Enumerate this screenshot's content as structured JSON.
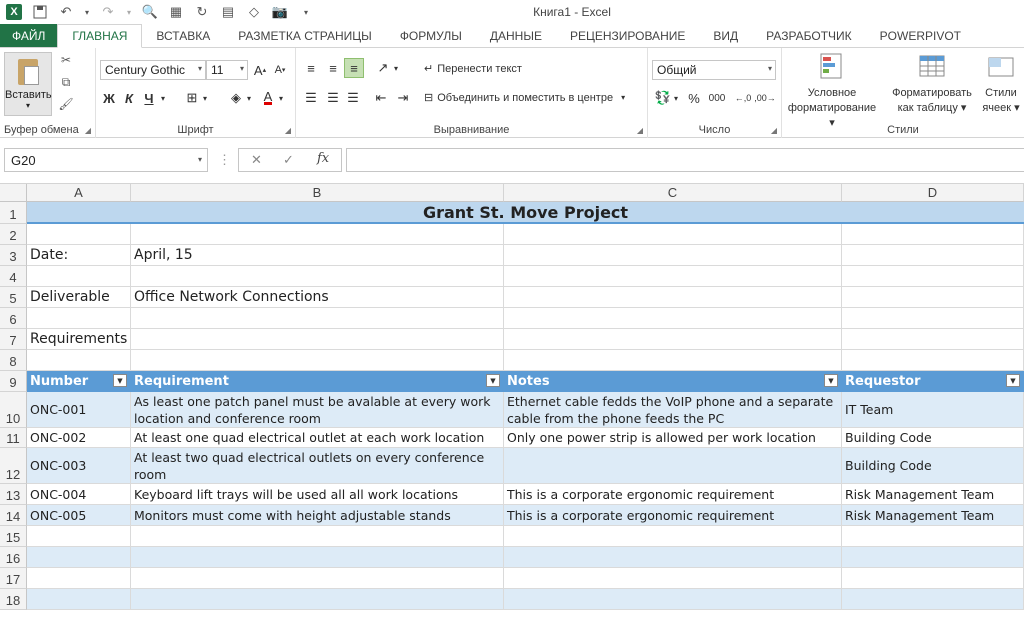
{
  "window": {
    "title": "Книга1 - Excel"
  },
  "ribbon_tabs": [
    "ФАЙЛ",
    "ГЛАВНАЯ",
    "ВСТАВКА",
    "РАЗМЕТКА СТРАНИЦЫ",
    "ФОРМУЛЫ",
    "ДАННЫЕ",
    "РЕЦЕНЗИРОВАНИЕ",
    "ВИД",
    "РАЗРАБОТЧИК",
    "POWERPIVOT"
  ],
  "active_tab": "ГЛАВНАЯ",
  "clipboard": {
    "paste_label": "Вставить",
    "group_label": "Буфер обмена"
  },
  "font": {
    "name": "Century Gothic",
    "size": "11",
    "bold": "Ж",
    "italic": "К",
    "underline": "Ч",
    "group_label": "Шрифт"
  },
  "alignment": {
    "wrap_text": "Перенести текст",
    "merge_center": "Объединить и поместить в центре",
    "group_label": "Выравнивание"
  },
  "number": {
    "format": "Общий",
    "group_label": "Число"
  },
  "styles": {
    "conditional": [
      "Условное",
      "форматирование"
    ],
    "as_table": [
      "Форматировать",
      "как таблицу"
    ],
    "cell_styles": [
      "Стили",
      "ячеек"
    ],
    "group_label": "Стили"
  },
  "formula_bar": {
    "name_box": "G20",
    "fx": "fx",
    "value": ""
  },
  "columns": [
    "A",
    "B",
    "C",
    "D"
  ],
  "rows": [
    "1",
    "2",
    "3",
    "4",
    "5",
    "6",
    "7",
    "8",
    "9",
    "10",
    "11",
    "12",
    "13",
    "14",
    "15",
    "16",
    "17",
    "18"
  ],
  "sheet": {
    "title": "Grant St. Move Project",
    "date_label": "Date:",
    "date_value": "April, 15",
    "deliverable_label": "Deliverable",
    "deliverable_value": "Office Network Connections",
    "requirements_label": "Requirements",
    "table_headers": [
      "Number",
      "Requirement",
      "Notes",
      "Requestor"
    ],
    "table_rows": [
      {
        "number": "ONC-001",
        "requirement": "As least one patch panel must be avalable at every work location and conference room",
        "notes": "Ethernet cable fedds the VoIP phone and a separate cable from the phone feeds the PC",
        "requestor": "IT Team"
      },
      {
        "number": "ONC-002",
        "requirement": "At least one quad electrical outlet at each work location",
        "notes": "Only one power strip is allowed per work location",
        "requestor": "Building Code"
      },
      {
        "number": "ONC-003",
        "requirement": "At least two quad electrical outlets on every conference room",
        "notes": "",
        "requestor": "Building Code"
      },
      {
        "number": "ONC-004",
        "requirement": "Keyboard lift trays will be used all all work locations",
        "notes": "This is a corporate ergonomic requirement",
        "requestor": "Risk Management Team"
      },
      {
        "number": "ONC-005",
        "requirement": "Monitors must come with height adjustable stands",
        "notes": "This is a corporate ergonomic requirement",
        "requestor": "Risk Management Team"
      }
    ]
  },
  "colors": {
    "accent": "#217346",
    "table_header": "#5b9bd5",
    "band": "#ddebf7",
    "title_fill": "#bdd7ee"
  }
}
